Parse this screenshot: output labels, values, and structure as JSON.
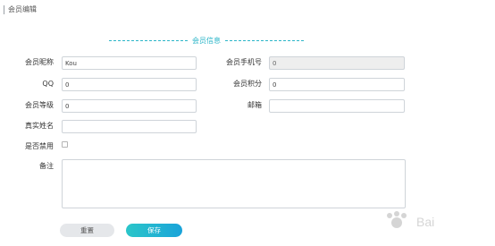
{
  "header": {
    "title": "会员编辑"
  },
  "section": {
    "title": "会员信息"
  },
  "form": {
    "nickname": {
      "label": "会员昵称",
      "value": "Kou"
    },
    "mobile": {
      "label": "会员手机号",
      "value": "0"
    },
    "qq": {
      "label": "QQ",
      "value": "0"
    },
    "points": {
      "label": "会员积分",
      "value": "0"
    },
    "level": {
      "label": "会员等级",
      "value": "0"
    },
    "email": {
      "label": "邮箱",
      "value": ""
    },
    "realname": {
      "label": "真实姓名",
      "value": ""
    },
    "disabled": {
      "label": "是否禁用",
      "checked": false
    },
    "remark": {
      "label": "备注",
      "value": ""
    }
  },
  "buttons": {
    "reset": "重置",
    "save": "保存"
  },
  "colors": {
    "accent": "#2bb5c8",
    "primary_button": "#1aa3d9"
  }
}
